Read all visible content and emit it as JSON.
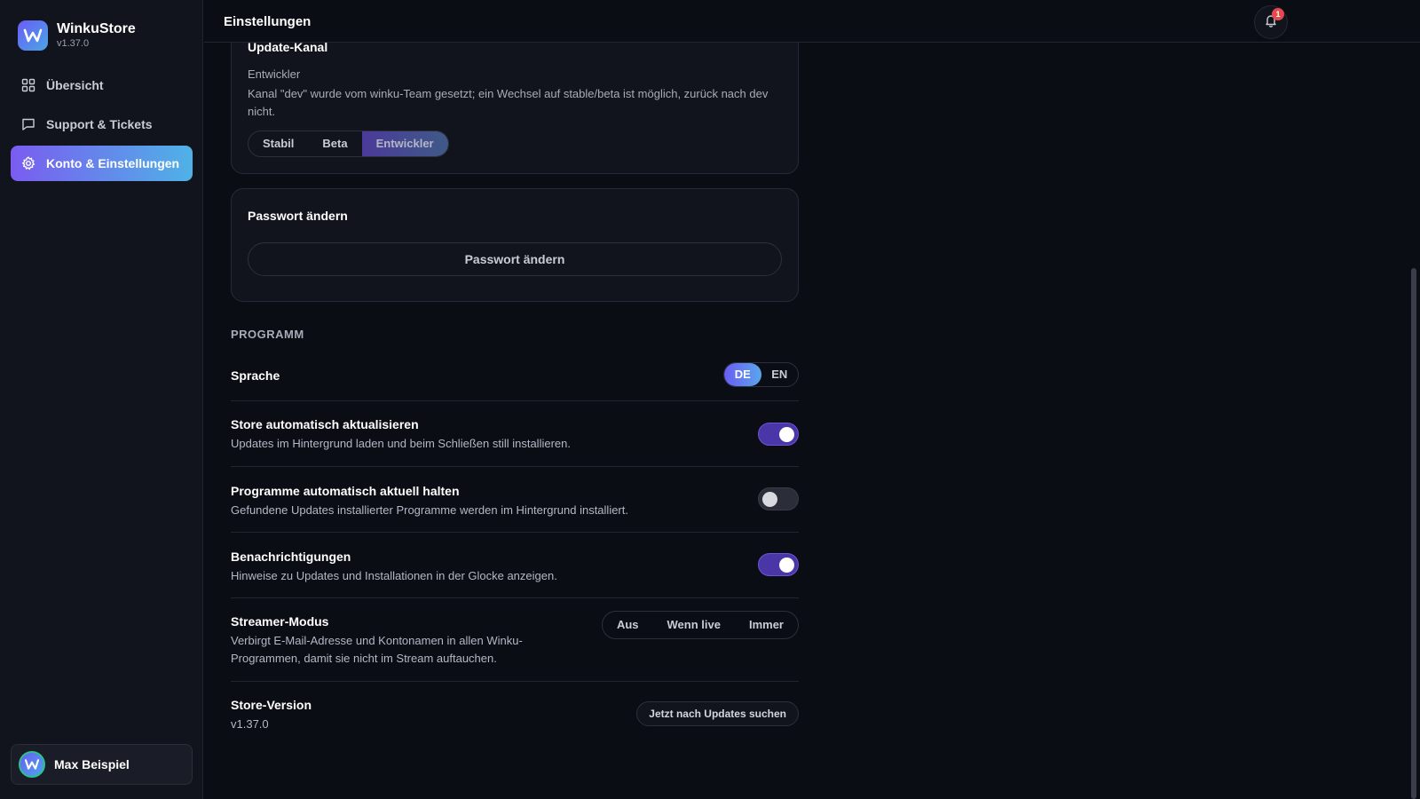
{
  "app": {
    "name": "WinkuStore",
    "version": "v1.37.0"
  },
  "sidebar": {
    "items": [
      {
        "label": "Übersicht",
        "icon": "grid-icon",
        "active": false
      },
      {
        "label": "Support & Tickets",
        "icon": "chat-icon",
        "active": false
      },
      {
        "label": "Konto & Einstellungen",
        "icon": "gear-icon",
        "active": true
      }
    ],
    "user": {
      "name": "Max Beispiel"
    }
  },
  "header": {
    "title": "Einstellungen",
    "notification_count": "1"
  },
  "update_channel": {
    "title": "Update-Kanal",
    "current": "Entwickler",
    "description": "Kanal \"dev\" wurde vom winku-Team gesetzt; ein Wechsel auf stable/beta ist möglich, zurück nach dev nicht.",
    "options": [
      "Stabil",
      "Beta",
      "Entwickler"
    ],
    "selected": "Entwickler"
  },
  "password": {
    "title": "Passwort ändern",
    "button_label": "Passwort ändern"
  },
  "program": {
    "section_label": "PROGRAMM",
    "language": {
      "title": "Sprache",
      "options": [
        "DE",
        "EN"
      ],
      "selected": "DE"
    },
    "auto_update_store": {
      "title": "Store automatisch aktualisieren",
      "description": "Updates im Hintergrund laden und beim Schließen still installieren.",
      "enabled": true
    },
    "auto_update_programs": {
      "title": "Programme automatisch aktuell halten",
      "description": "Gefundene Updates installierter Programme werden im Hintergrund installiert.",
      "enabled": false
    },
    "notifications": {
      "title": "Benachrichtigungen",
      "description": "Hinweise zu Updates und Installationen in der Glocke anzeigen.",
      "enabled": true
    },
    "streamer_mode": {
      "title": "Streamer-Modus",
      "description_line1": "Verbirgt E-Mail-Adresse und Kontonamen in allen Winku-",
      "description_line2": "Programmen, damit sie nicht im Stream auftauchen.",
      "options": [
        "Aus",
        "Wenn live",
        "Immer"
      ]
    },
    "store_version": {
      "title": "Store-Version",
      "value": "v1.37.0",
      "button_label": "Jetzt nach Updates suchen"
    }
  },
  "colors": {
    "background": "#0b0d14",
    "sidebar": "#12141d",
    "accent_start": "#7a5cf0",
    "accent_end": "#4fb2e6",
    "toggle_on": "#4b36a8",
    "badge": "#e5484d"
  }
}
